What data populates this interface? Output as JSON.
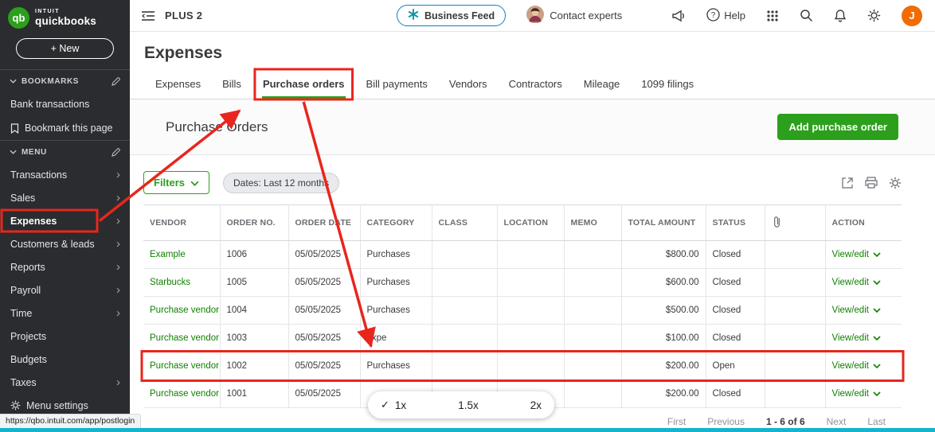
{
  "colors": {
    "qb_green": "#2ca01c",
    "link_green": "#108000",
    "annotation_red": "#e8261d",
    "sidebar_bg": "#2a2c2f",
    "avatar_orange": "#ef6c00",
    "teal_bar": "#12b5cb",
    "business_feed_border": "#0f80c1"
  },
  "sidebar": {
    "logo": {
      "initials": "qb",
      "line1": "INTUIT",
      "line2": "quickbooks"
    },
    "new_button_label": "+ New",
    "bookmarks": {
      "header": "BOOKMARKS",
      "items": [
        {
          "label": "Bank transactions"
        },
        {
          "label": "Bookmark this page",
          "icon": "bookmark"
        }
      ]
    },
    "menu": {
      "header": "MENU",
      "items": [
        {
          "label": "Transactions",
          "chevron": true
        },
        {
          "label": "Sales",
          "chevron": true
        },
        {
          "label": "Expenses",
          "chevron": true,
          "selected": true
        },
        {
          "label": "Customers & leads",
          "chevron": true
        },
        {
          "label": "Reports",
          "chevron": true
        },
        {
          "label": "Payroll",
          "chevron": true
        },
        {
          "label": "Time",
          "chevron": true
        },
        {
          "label": "Projects"
        },
        {
          "label": "Budgets"
        },
        {
          "label": "Taxes",
          "chevron": true
        },
        {
          "label": "Menu settings",
          "icon": "gear"
        }
      ]
    }
  },
  "topbar": {
    "company_name": "PLUS 2",
    "business_feed_label": "Business Feed",
    "contact_experts_label": "Contact experts",
    "help_label": "Help",
    "user_initial": "J"
  },
  "page": {
    "title": "Expenses",
    "tabs": [
      "Expenses",
      "Bills",
      "Purchase orders",
      "Bill payments",
      "Vendors",
      "Contractors",
      "Mileage",
      "1099 filings"
    ],
    "selected_tab": "Purchase orders",
    "section_title": "Purchase Orders",
    "add_button_label": "Add purchase order",
    "filters_button_label": "Filters",
    "dates_filter_label": "Dates: Last 12 months"
  },
  "table": {
    "columns": [
      {
        "label": "VENDOR"
      },
      {
        "label": "ORDER NO."
      },
      {
        "label": "ORDER DATE"
      },
      {
        "label": "CATEGORY"
      },
      {
        "label": "CLASS"
      },
      {
        "label": "LOCATION"
      },
      {
        "label": "MEMO"
      },
      {
        "label": "TOTAL AMOUNT"
      },
      {
        "label": "STATUS"
      },
      {
        "label": "",
        "icon": "paperclip"
      },
      {
        "label": "ACTION"
      }
    ],
    "rows": [
      {
        "vendor": "Example",
        "order_no": "1006",
        "order_date": "05/05/2025",
        "category": "Purchases",
        "class": "",
        "location": "",
        "memo": "",
        "total_amount": "$800.00",
        "status": "Closed",
        "action": "View/edit"
      },
      {
        "vendor": "Starbucks",
        "order_no": "1005",
        "order_date": "05/05/2025",
        "category": "Purchases",
        "class": "",
        "location": "",
        "memo": "",
        "total_amount": "$600.00",
        "status": "Closed",
        "action": "View/edit"
      },
      {
        "vendor": "Purchase vendor",
        "order_no": "1004",
        "order_date": "05/05/2025",
        "category": "Purchases",
        "class": "",
        "location": "",
        "memo": "",
        "total_amount": "$500.00",
        "status": "Closed",
        "action": "View/edit"
      },
      {
        "vendor": "Purchase vendor",
        "order_no": "1003",
        "order_date": "05/05/2025",
        "category": "expe",
        "class": "",
        "location": "",
        "memo": "",
        "total_amount": "$100.00",
        "status": "Closed",
        "action": "View/edit"
      },
      {
        "vendor": "Purchase vendor",
        "order_no": "1002",
        "order_date": "05/05/2025",
        "category": "Purchases",
        "class": "",
        "location": "",
        "memo": "",
        "total_amount": "$200.00",
        "status": "Open",
        "action": "View/edit",
        "highlighted": true
      },
      {
        "vendor": "Purchase vendor",
        "order_no": "1001",
        "order_date": "05/05/2025",
        "category": "",
        "class": "",
        "location": "",
        "memo": "",
        "total_amount": "$200.00",
        "status": "Closed",
        "action": "View/edit"
      }
    ]
  },
  "pagination": {
    "items": [
      "First",
      "Previous",
      "1 - 6 of 6",
      "Next",
      "Last"
    ],
    "current": "1 - 6 of 6"
  },
  "zoom_control": {
    "options": [
      "1x",
      "1.5x",
      "2x"
    ],
    "selected": "1x",
    "check_glyph": "✓"
  },
  "statusbar": {
    "url": "https://qbo.intuit.com/app/postlogin"
  }
}
